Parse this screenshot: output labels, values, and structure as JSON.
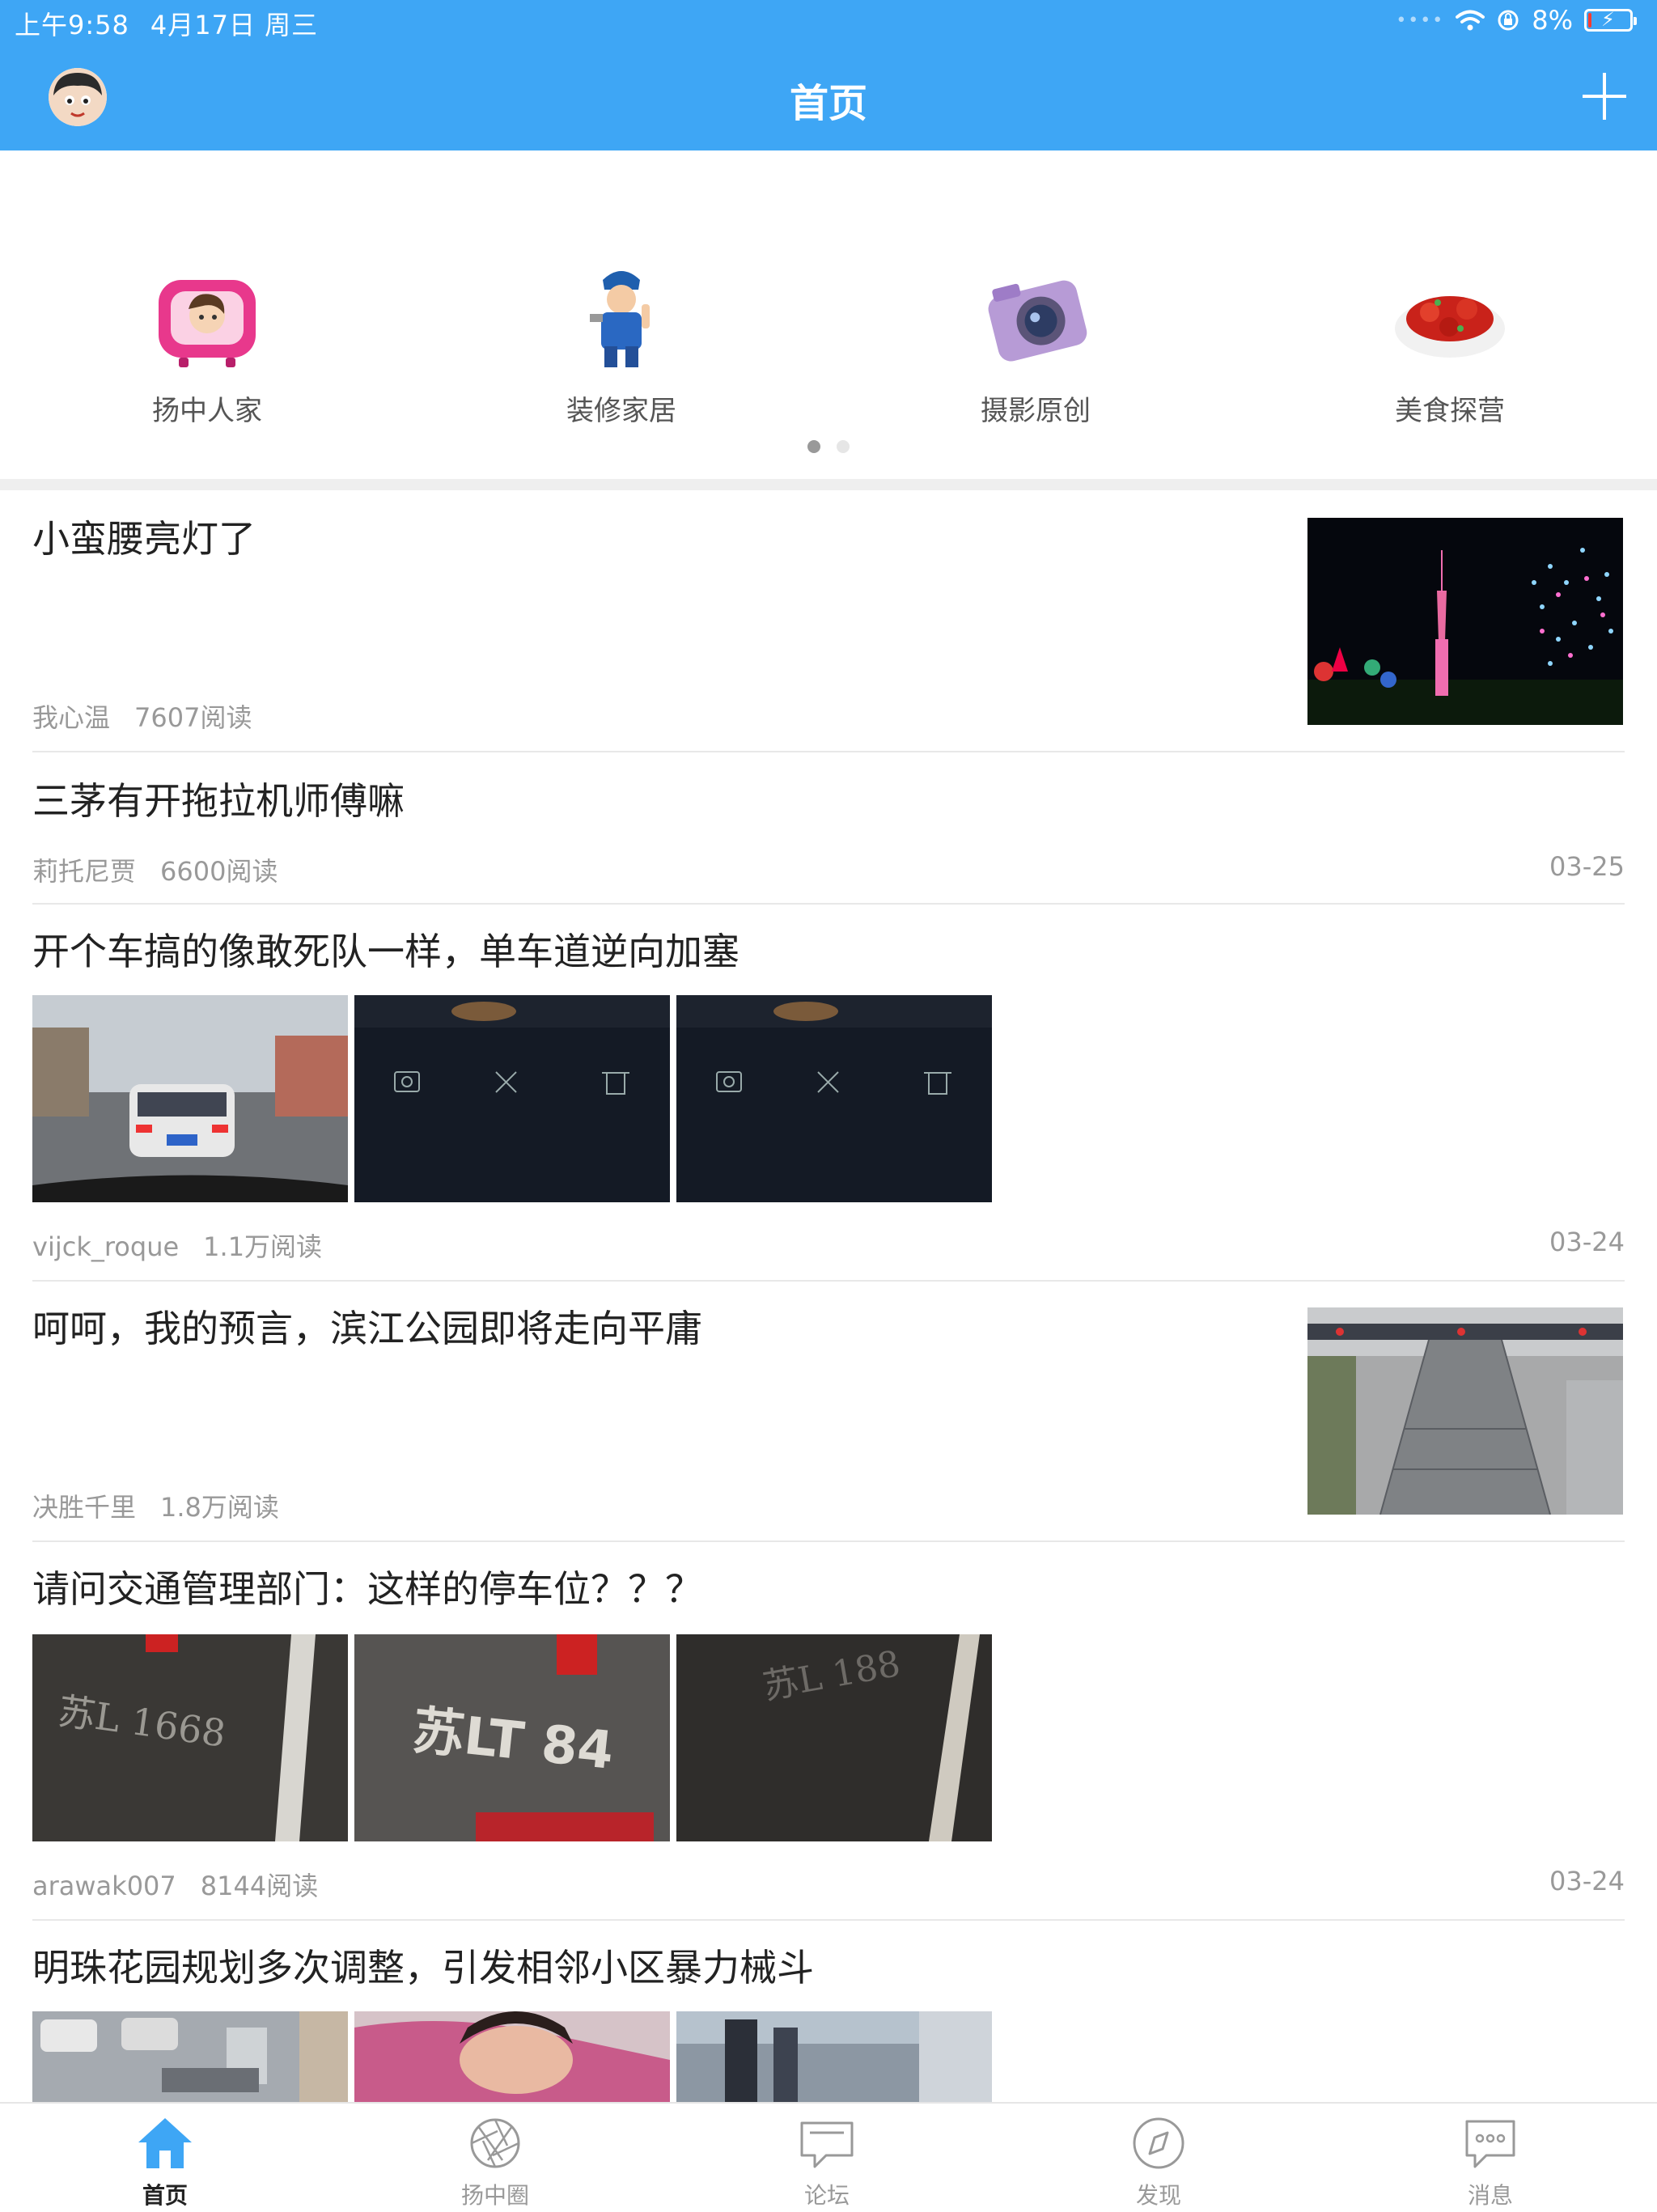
{
  "status_bar": {
    "time": "上午9:58",
    "date": "4月17日 周三",
    "battery": "8%"
  },
  "header": {
    "title": "首页"
  },
  "categories": [
    {
      "label": "扬中人家",
      "icon": "tv-character-icon"
    },
    {
      "label": "装修家居",
      "icon": "worker-icon"
    },
    {
      "label": "摄影原创",
      "icon": "camera-icon"
    },
    {
      "label": "美食探营",
      "icon": "crawfish-icon"
    }
  ],
  "posts": [
    {
      "title": "小蛮腰亮灯了",
      "author": "我心温",
      "reads": "7607阅读",
      "date": ""
    },
    {
      "title": "三茅有开拖拉机师傅嘛",
      "author": "莉托尼贾",
      "reads": "6600阅读",
      "date": "03-25"
    },
    {
      "title": "开个车搞的像敢死队一样，单车道逆向加塞",
      "author": "vijck_roque",
      "reads": "1.1万阅读",
      "date": "03-24",
      "image_labels": [
        "视频截图",
        "视频剪辑",
        "删除视频"
      ]
    },
    {
      "title": "呵呵，我的预言，滨江公园即将走向平庸",
      "author": "决胜千里",
      "reads": "1.8万阅读",
      "date": ""
    },
    {
      "title": "请问交通管理部门：这样的停车位？？？",
      "author": "arawak007",
      "reads": "8144阅读",
      "date": "03-24",
      "plates": [
        "苏L 1668",
        "苏LT 84",
        "苏L 188"
      ]
    },
    {
      "title": "明珠花园规划多次调整，引发相邻小区暴力械斗",
      "author": "",
      "reads": "",
      "date": ""
    }
  ],
  "tabbar": [
    {
      "label": "首页",
      "icon": "home-icon",
      "active": true
    },
    {
      "label": "扬中圈",
      "icon": "aperture-icon",
      "active": false
    },
    {
      "label": "论坛",
      "icon": "forum-icon",
      "active": false
    },
    {
      "label": "发现",
      "icon": "compass-icon",
      "active": false
    },
    {
      "label": "消息",
      "icon": "message-icon",
      "active": false
    }
  ],
  "colors": {
    "primary": "#3ea6f5",
    "meta_text": "#999999",
    "battery_low": "#ff3b30"
  }
}
